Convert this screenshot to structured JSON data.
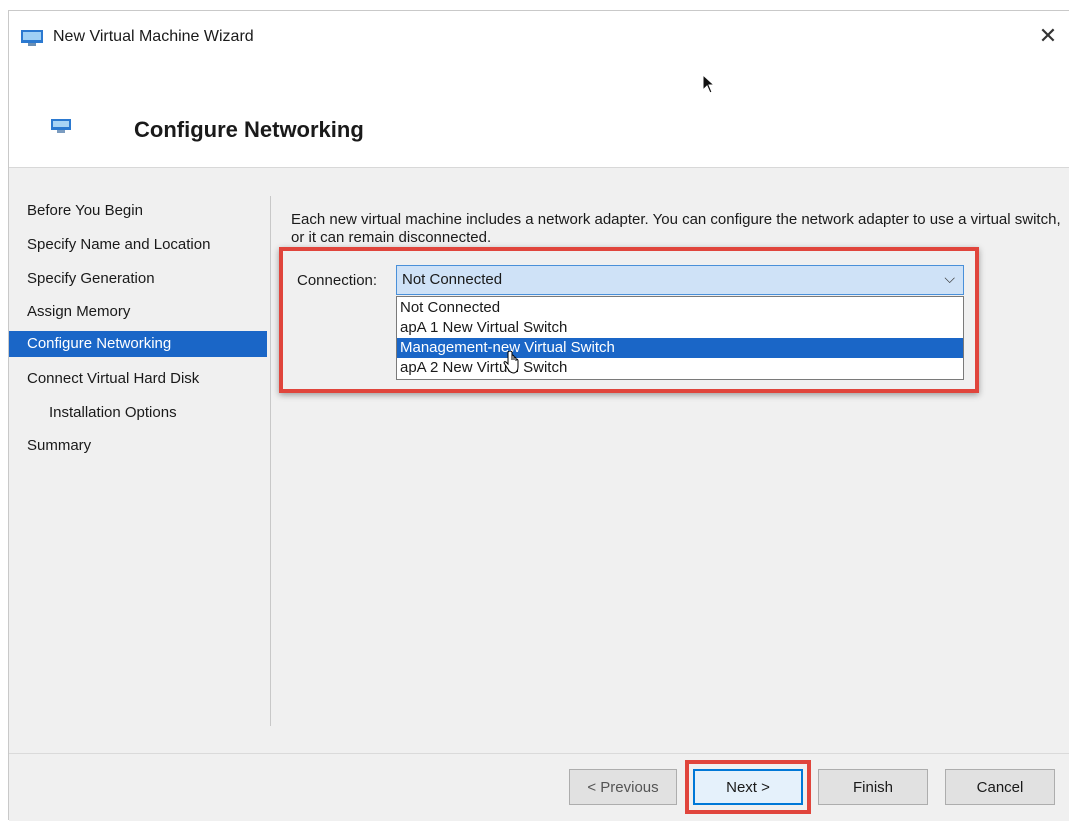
{
  "window": {
    "title": "New Virtual Machine Wizard",
    "close_glyph": "✕",
    "app_icon": "hyperv-vm-icon"
  },
  "header": {
    "title": "Configure Networking",
    "icon": "network-adapter-icon"
  },
  "steps": [
    {
      "label": "Before You Begin",
      "active": false,
      "indent": false
    },
    {
      "label": "Specify Name and Location",
      "active": false,
      "indent": false
    },
    {
      "label": "Specify Generation",
      "active": false,
      "indent": false
    },
    {
      "label": "Assign Memory",
      "active": false,
      "indent": false
    },
    {
      "label": "Configure Networking",
      "active": true,
      "indent": false
    },
    {
      "label": "Connect Virtual Hard Disk",
      "active": false,
      "indent": false
    },
    {
      "label": "Installation Options",
      "active": false,
      "indent": true
    },
    {
      "label": "Summary",
      "active": false,
      "indent": false
    }
  ],
  "main": {
    "description": "Each new virtual machine includes a network adapter. You can configure the network adapter to use a virtual switch, or it can remain disconnected.",
    "connection_label": "Connection:",
    "connection_value": "Not Connected",
    "chevron_glyph": "⌵",
    "options": [
      {
        "label": "Not Connected",
        "selected": false
      },
      {
        "label": "apA 1 New Virtual Switch",
        "selected": false
      },
      {
        "label": "Management-new Virtual Switch",
        "selected": true
      },
      {
        "label": "apA 2 New Virtual Switch",
        "selected": false
      }
    ]
  },
  "footer": {
    "previous_label": "< Previous",
    "next_label": "Next >",
    "finish_label": "Finish",
    "cancel_label": "Cancel"
  },
  "colors": {
    "selection": "#1a66c7",
    "highlight_box": "#e0453c",
    "combo_bg": "#cfe2f7"
  }
}
